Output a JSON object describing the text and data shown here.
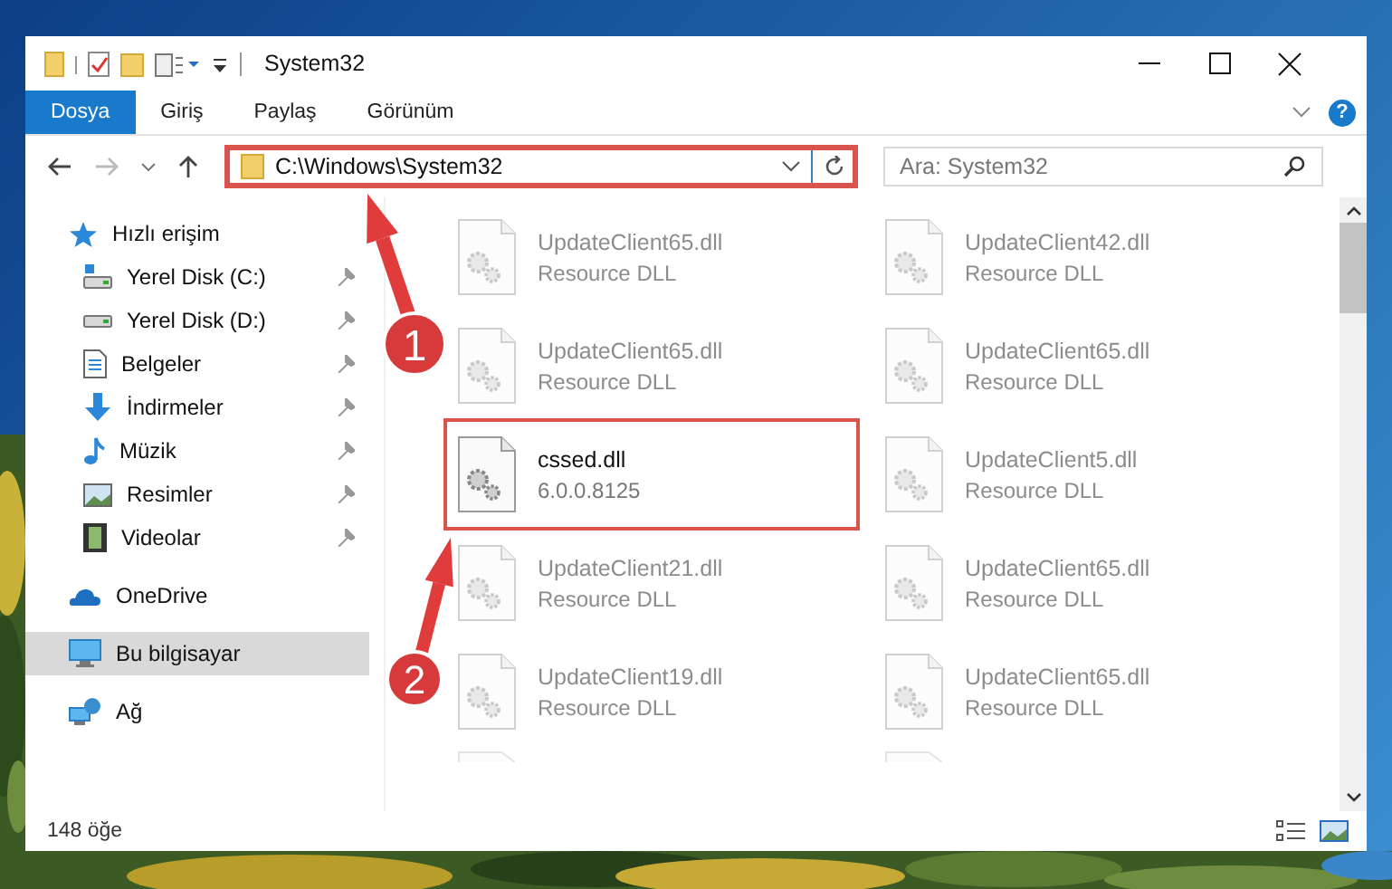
{
  "window": {
    "title": "System32"
  },
  "ribbon": {
    "tabs": [
      {
        "label": "Dosya",
        "selected": true
      },
      {
        "label": "Giriş",
        "selected": false
      },
      {
        "label": "Paylaş",
        "selected": false
      },
      {
        "label": "Görünüm",
        "selected": false
      }
    ],
    "help": "?"
  },
  "address": {
    "path": "C:\\Windows\\System32",
    "highlighted": true
  },
  "search": {
    "placeholder": "Ara: System32"
  },
  "sidebar": {
    "items": [
      {
        "label": "Hızlı erişim",
        "selected": false,
        "children": [
          {
            "label": "Yerel Disk (C:)",
            "pinned": true,
            "selected": false
          },
          {
            "label": "Yerel Disk (D:)",
            "pinned": true,
            "selected": false
          },
          {
            "label": "Belgeler",
            "pinned": true,
            "selected": false
          },
          {
            "label": "İndirmeler",
            "pinned": true,
            "selected": false
          },
          {
            "label": "Müzik",
            "pinned": true,
            "selected": false
          },
          {
            "label": "Resimler",
            "pinned": true,
            "selected": false
          },
          {
            "label": "Videolar",
            "pinned": true,
            "selected": false
          }
        ]
      },
      {
        "label": "OneDrive",
        "selected": false
      },
      {
        "label": "Bu bilgisayar",
        "selected": true
      },
      {
        "label": "Ağ",
        "selected": false
      }
    ]
  },
  "files": [
    {
      "name": "UpdateClient65.dll",
      "detail": "Resource DLL",
      "dimmed": true,
      "highlighted": false
    },
    {
      "name": "UpdateClient42.dll",
      "detail": "Resource DLL",
      "dimmed": true,
      "highlighted": false
    },
    {
      "name": "UpdateClient65.dll",
      "detail": "Resource DLL",
      "dimmed": true,
      "highlighted": false
    },
    {
      "name": "UpdateClient65.dll",
      "detail": "Resource DLL",
      "dimmed": true,
      "highlighted": false
    },
    {
      "name": "cssed.dll",
      "detail": "6.0.0.8125",
      "dimmed": false,
      "highlighted": true
    },
    {
      "name": "UpdateClient5.dll",
      "detail": "Resource DLL",
      "dimmed": true,
      "highlighted": false
    },
    {
      "name": "UpdateClient21.dll",
      "detail": "Resource DLL",
      "dimmed": true,
      "highlighted": false
    },
    {
      "name": "UpdateClient65.dll",
      "detail": "Resource DLL",
      "dimmed": true,
      "highlighted": false
    },
    {
      "name": "UpdateClient19.dll",
      "detail": "Resource DLL",
      "dimmed": true,
      "highlighted": false
    },
    {
      "name": "UpdateClient65.dll",
      "detail": "Resource DLL",
      "dimmed": true,
      "highlighted": false
    }
  ],
  "status_bar": {
    "count": "148 öğe"
  },
  "annotations": [
    {
      "label": "1"
    },
    {
      "label": "2"
    }
  ]
}
